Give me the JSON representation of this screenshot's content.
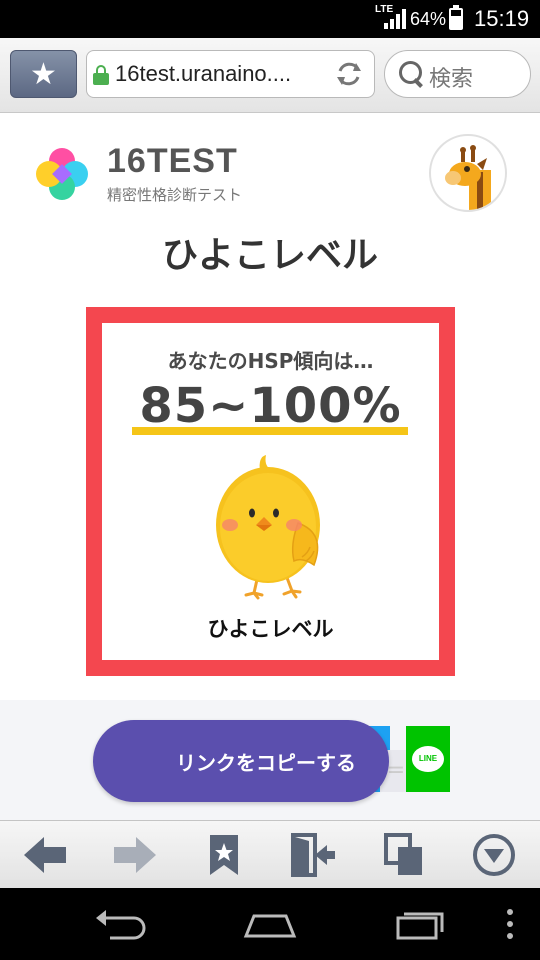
{
  "status_bar": {
    "network": "LTE",
    "battery_percent": "64%",
    "time": "15:19"
  },
  "browser": {
    "url": "16test.uranaino....",
    "search_placeholder": "検索",
    "icons": [
      "star-icon",
      "lock-icon",
      "reload-icon",
      "search-icon"
    ]
  },
  "site": {
    "brand": "16TEST",
    "tagline": "精密性格診断テスト"
  },
  "page_title": "ひよこレベル",
  "result": {
    "question": "あなたのHSP傾向は…",
    "score": "85~100%",
    "level": "ひよこレベル"
  },
  "share": {
    "copy_link_label": "リンクをコピーする",
    "line_label": "LINE"
  },
  "colors": {
    "card_border": "#f4474f",
    "underline": "#f5c518",
    "copy_button": "#5b4fae",
    "line_green": "#00c300"
  },
  "bottom_toolbar": [
    "back-icon",
    "forward-icon",
    "bookmarks-icon",
    "exit-icon",
    "tabs-icon",
    "menu-icon"
  ],
  "system_nav": [
    "nav-back-icon",
    "nav-home-icon",
    "nav-recents-icon",
    "nav-more-icon"
  ]
}
